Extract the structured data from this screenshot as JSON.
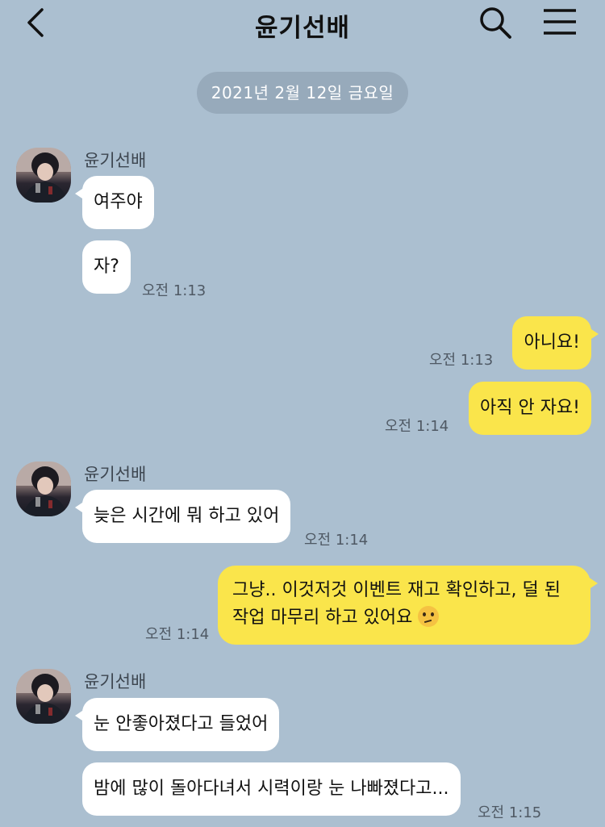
{
  "header": {
    "title": "윤기선배"
  },
  "date_divider": "2021년 2월 12일 금요일",
  "messages": [
    {
      "sender": "윤기선배",
      "text": "여주야"
    },
    {
      "text": "자?",
      "time": "오전 1:13"
    },
    {
      "text": "아니요!",
      "time": "오전 1:13"
    },
    {
      "text": "아직 안 자요!",
      "time": "오전 1:14"
    },
    {
      "sender": "윤기선배",
      "text": "늦은 시간에 뭐 하고 있어",
      "time": "오전 1:14"
    },
    {
      "text": "그냥.. 이것저것 이벤트 재고 확인하고, 덜 된 작업 마무리 하고 있어요",
      "emoji": "thinking-face-emoji",
      "time": "오전 1:14"
    },
    {
      "sender": "윤기선배",
      "text": "눈 안좋아졌다고 들었어"
    },
    {
      "text": "밤에 많이 돌아다녀서 시력이랑 눈 나빠졌다고...",
      "time": "오전 1:15"
    }
  ],
  "colors": {
    "background": "#abbfd0",
    "outgoing_bubble": "#fae54b",
    "incoming_bubble": "#ffffff",
    "date_pill": "#97aabb"
  }
}
